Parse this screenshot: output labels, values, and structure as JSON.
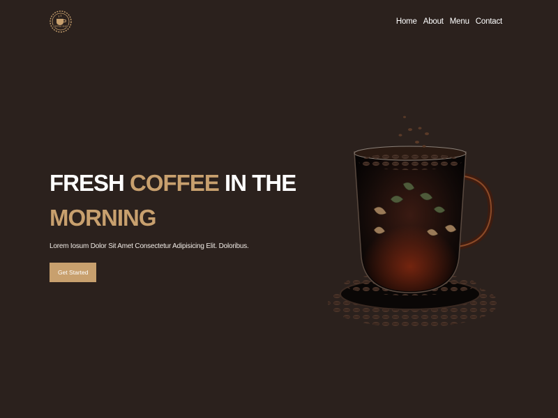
{
  "brand": {
    "logo_text": "COFFEE SHOP",
    "logo_icon": "coffee-cup-gear-icon",
    "accent_color": "#c8a06e",
    "background_color": "#2b211d"
  },
  "nav": {
    "items": [
      "Home",
      "About",
      "Menu",
      "Contact"
    ]
  },
  "hero": {
    "headline_part1": "FRESH",
    "headline_accent1": "COFFEE",
    "headline_part2": "IN THE",
    "headline_accent2": "MORNING",
    "subtitle": "Lorem Iosum Dolor Sit Amet Consectetur Adipisicing Elit. Doloribus.",
    "cta_label": "Get Started"
  },
  "hero_image": {
    "subject": "coffee-cup-image"
  }
}
